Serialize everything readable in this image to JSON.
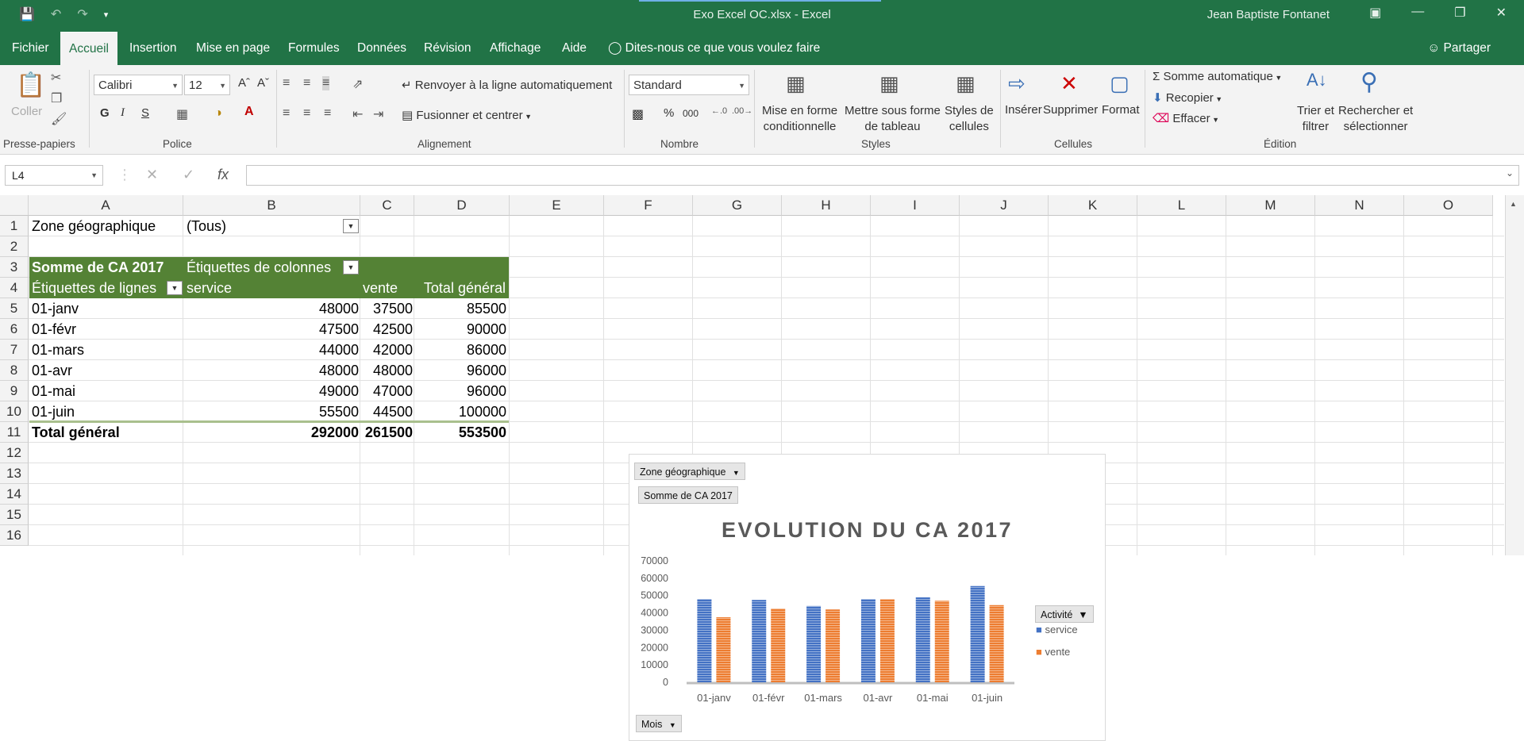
{
  "window": {
    "title": "Exo Excel OC.xlsx  -  Excel",
    "user": "Jean Baptiste Fontanet"
  },
  "menu": {
    "tabs": [
      "Fichier",
      "Accueil",
      "Insertion",
      "Mise en page",
      "Formules",
      "Données",
      "Révision",
      "Affichage",
      "Aide"
    ],
    "active_tab": "Accueil",
    "tell_me": "Dites-nous ce que vous voulez faire",
    "share": "Partager"
  },
  "ribbon": {
    "clipboard": {
      "paste": "Coller",
      "group": "Presse-papiers"
    },
    "font": {
      "name": "Calibri",
      "size": "12",
      "bold": "G",
      "italic": "I",
      "underline": "S",
      "group": "Police"
    },
    "alignment": {
      "wrap": "Renvoyer à la ligne automatiquement",
      "merge": "Fusionner et centrer",
      "group": "Alignement"
    },
    "number": {
      "format": "Standard",
      "percent": "%",
      "thousands": "000",
      "group": "Nombre"
    },
    "styles": {
      "conditional": [
        "Mise en forme",
        "conditionnelle"
      ],
      "table": [
        "Mettre sous forme",
        "de tableau"
      ],
      "cell_styles": [
        "Styles de",
        "cellules"
      ],
      "group": "Styles"
    },
    "cells": {
      "insert": "Insérer",
      "delete": "Supprimer",
      "format": "Format",
      "group": "Cellules"
    },
    "editing": {
      "autosum": "Somme automatique",
      "fill": "Recopier",
      "clear": "Effacer",
      "sort": [
        "Trier et",
        "filtrer"
      ],
      "find": [
        "Rechercher et",
        "sélectionner"
      ],
      "group": "Édition"
    }
  },
  "formula_bar": {
    "name_box": "L4",
    "fx": "fx",
    "formula": ""
  },
  "sheet": {
    "columns": [
      "A",
      "B",
      "C",
      "D",
      "E",
      "F",
      "G",
      "H",
      "I",
      "J",
      "K",
      "L",
      "M",
      "N",
      "O"
    ],
    "rows": [
      "1",
      "2",
      "3",
      "4",
      "5",
      "6",
      "7",
      "8",
      "9",
      "10",
      "11",
      "12",
      "13",
      "14",
      "15",
      "16"
    ],
    "filter_label": "Zone géographique",
    "filter_value": "(Tous)",
    "pivot": {
      "value_label": "Somme de CA 2017",
      "col_labels": "Étiquettes de colonnes",
      "row_labels": "Étiquettes de lignes",
      "headers": [
        "service",
        "vente",
        "Total général"
      ],
      "rows": [
        {
          "label": "01-janv",
          "service": "48000",
          "vente": "37500",
          "total": "85500"
        },
        {
          "label": "01-févr",
          "service": "47500",
          "vente": "42500",
          "total": "90000"
        },
        {
          "label": "01-mars",
          "service": "44000",
          "vente": "42000",
          "total": "86000"
        },
        {
          "label": "01-avr",
          "service": "48000",
          "vente": "48000",
          "total": "96000"
        },
        {
          "label": "01-mai",
          "service": "49000",
          "vente": "47000",
          "total": "96000"
        },
        {
          "label": "01-juin",
          "service": "55500",
          "vente": "44500",
          "total": "100000"
        }
      ],
      "grand_total": {
        "label": "Total général",
        "service": "292000",
        "vente": "261500",
        "total": "553500"
      }
    }
  },
  "chart_data": {
    "type": "bar",
    "title": "EVOLUTION DU CA 2017",
    "categories": [
      "01-janv",
      "01-févr",
      "01-mars",
      "01-avr",
      "01-mai",
      "01-juin"
    ],
    "series": [
      {
        "name": "service",
        "color": "#4472c4",
        "values": [
          48000,
          47500,
          44000,
          48000,
          49000,
          55500
        ]
      },
      {
        "name": "vente",
        "color": "#ed7d31",
        "values": [
          37500,
          42500,
          42000,
          48000,
          47000,
          44500
        ]
      }
    ],
    "y_ticks": [
      "0",
      "10000",
      "20000",
      "30000",
      "40000",
      "50000",
      "60000",
      "70000"
    ],
    "ylim": [
      0,
      70000
    ],
    "legend_title": "Activité",
    "legend_position": "right",
    "filter_button": "Zone géographique",
    "value_button": "Somme de CA 2017",
    "axis_button": "Mois"
  }
}
